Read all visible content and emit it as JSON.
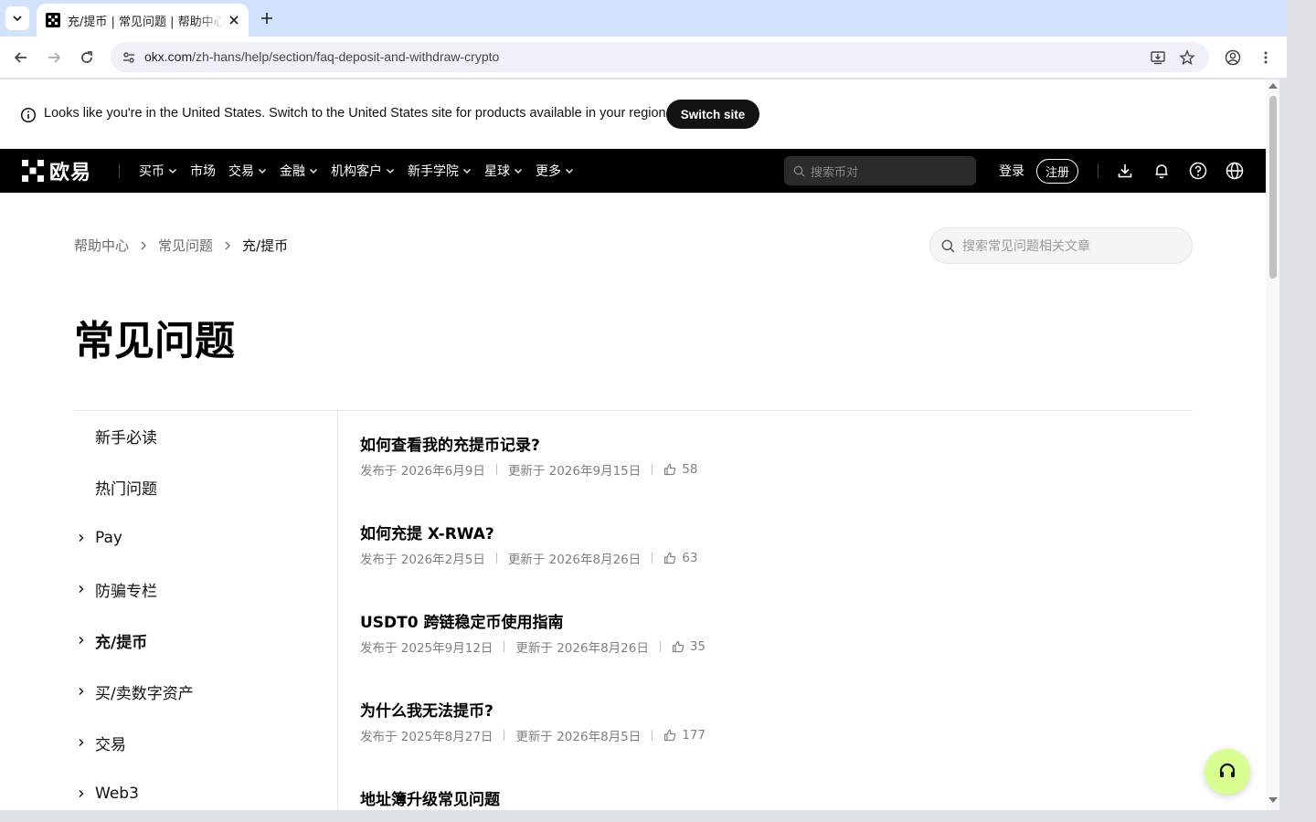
{
  "browser": {
    "tab_title": "充/提币 | 常见问题 | 帮助中心",
    "url_host": "okx.com",
    "url_path": "/zh-hans/help/section/faq-deposit-and-withdraw-crypto"
  },
  "banner": {
    "message": "Looks like you're in the United States. Switch to the United States site for products available in your region.",
    "switch_label": "Switch site"
  },
  "header": {
    "logo_text": "欧易",
    "nav": [
      {
        "label": "买币",
        "has_menu": true
      },
      {
        "label": "市场",
        "has_menu": false
      },
      {
        "label": "交易",
        "has_menu": true
      },
      {
        "label": "金融",
        "has_menu": true
      },
      {
        "label": "机构客户",
        "has_menu": true
      },
      {
        "label": "新手学院",
        "has_menu": true
      },
      {
        "label": "星球",
        "has_menu": true
      },
      {
        "label": "更多",
        "has_menu": true
      }
    ],
    "search_placeholder": "搜索币对",
    "login_label": "登录",
    "signup_label": "注册",
    "icons": [
      "download-icon",
      "bell-icon",
      "help-icon",
      "globe-icon"
    ]
  },
  "breadcrumb": {
    "items": [
      "帮助中心",
      "常见问题",
      "充/提币"
    ]
  },
  "faq_search_placeholder": "搜索常见问题相关文章",
  "page_title": "常见问题",
  "sidebar": {
    "items": [
      {
        "label": "新手必读",
        "expandable": false,
        "active": false
      },
      {
        "label": "热门问题",
        "expandable": false,
        "active": false
      },
      {
        "label": "Pay",
        "expandable": true,
        "active": false
      },
      {
        "label": "防骗专栏",
        "expandable": true,
        "active": false
      },
      {
        "label": "充/提币",
        "expandable": true,
        "active": true
      },
      {
        "label": "买/卖数字资产",
        "expandable": true,
        "active": false
      },
      {
        "label": "交易",
        "expandable": true,
        "active": false
      },
      {
        "label": "Web3",
        "expandable": true,
        "active": false
      }
    ]
  },
  "articles": [
    {
      "title": "如何查看我的充提币记录?",
      "published": "发布于 2026年6月9日",
      "updated": "更新于 2026年9月15日",
      "likes": "58"
    },
    {
      "title": "如何充提 X-RWA?",
      "published": "发布于 2026年2月5日",
      "updated": "更新于 2026年8月26日",
      "likes": "63"
    },
    {
      "title": "USDT0 跨链稳定币使用指南",
      "published": "发布于 2025年9月12日",
      "updated": "更新于 2026年8月26日",
      "likes": "35"
    },
    {
      "title": "为什么我无法提币?",
      "published": "发布于 2025年8月27日",
      "updated": "更新于 2026年8月5日",
      "likes": "177"
    },
    {
      "title": "地址簿升级常见问题",
      "published": "",
      "updated": "",
      "likes": ""
    }
  ],
  "colors": {
    "header_bg": "#000000",
    "banner_button_bg": "#121212",
    "support_fab_bg": "#d8ff8f",
    "tabbar_bg": "#d3e3fd"
  }
}
